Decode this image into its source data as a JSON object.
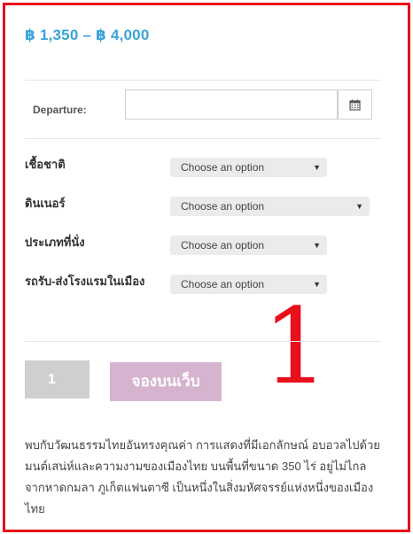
{
  "price_range": "฿ 1,350 – ฿ 4,000",
  "departure": {
    "label": "Departure:",
    "value": "",
    "calendar_icon": "calendar-icon"
  },
  "options": [
    {
      "label": "เชื้อชาติ",
      "selected": "Choose an option"
    },
    {
      "label": "ดินเนอร์",
      "selected": "Choose an option"
    },
    {
      "label": "ประเภทที่นั่ง",
      "selected": "Choose an option"
    },
    {
      "label": "รถรับ-ส่งโรงแรมในเมือง",
      "selected": "Choose an option"
    }
  ],
  "quantity": "1",
  "book_button": "จองบนเว็บ",
  "annotation": "1",
  "description": "พบกับวัฒนธรรมไทยอันทรงคุณค่า การแสดงที่มีเอกลักษณ์ อบอวลไปด้วยมนต์เสน่ห์และความงามของเมืองไทย บนพื้นที่ขนาด 350 ไร่ อยู่ไม่ไกลจากหาดกมลา ภูเก็ตแฟนตาซี เป็นหนึ่งในสิ่งมหัศจรรย์แห่งหนึ่งของเมืองไทย",
  "colors": {
    "price": "#3ba4d9",
    "annotation_border": "#e8101a",
    "book_button": "#d6b4d0",
    "quantity_box": "#cfcfcf"
  }
}
